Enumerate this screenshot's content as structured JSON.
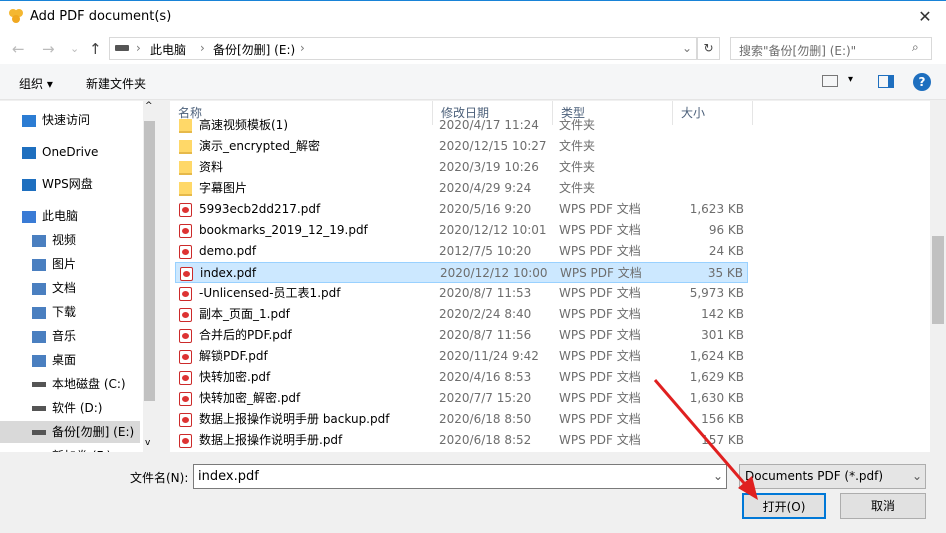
{
  "window": {
    "title": "Add PDF document(s)",
    "close": "✕"
  },
  "nav": {
    "back": "←",
    "forward": "→",
    "recent": "⌄",
    "up": "↑",
    "refresh": "↻",
    "path": [
      "此电脑",
      "备份[勿删] (E:)"
    ],
    "search_placeholder": "搜索\"备份[勿删] (E:)\""
  },
  "toolbar": {
    "organize": "组织 ▾",
    "new_folder": "新建文件夹",
    "help": "?"
  },
  "sidebar": {
    "items": [
      {
        "label": "快速访问",
        "icon": "star-icon"
      },
      {
        "label": "OneDrive",
        "icon": "cloud-icon"
      },
      {
        "label": "WPS网盘",
        "icon": "cloud-icon"
      },
      {
        "label": "此电脑",
        "icon": "computer-icon"
      },
      {
        "label": "视频",
        "icon": "video-icon"
      },
      {
        "label": "图片",
        "icon": "picture-icon"
      },
      {
        "label": "文档",
        "icon": "document-icon"
      },
      {
        "label": "下载",
        "icon": "download-icon"
      },
      {
        "label": "音乐",
        "icon": "music-icon"
      },
      {
        "label": "桌面",
        "icon": "desktop-icon"
      },
      {
        "label": "本地磁盘 (C:)",
        "icon": "drive-icon"
      },
      {
        "label": "软件 (D:)",
        "icon": "drive-icon"
      },
      {
        "label": "备份[勿删] (E:)",
        "icon": "drive-icon",
        "selected": true
      },
      {
        "label": "新加卷 (F:)",
        "icon": "drive-icon"
      }
    ]
  },
  "columns": [
    "名称",
    "修改日期",
    "类型",
    "大小"
  ],
  "files": [
    {
      "name": "高速视频模板(1)",
      "date": "2020/4/17 11:24",
      "type": "文件夹",
      "size": "",
      "kind": "folder"
    },
    {
      "name": "演示_encrypted_解密",
      "date": "2020/12/15 10:27",
      "type": "文件夹",
      "size": "",
      "kind": "folder"
    },
    {
      "name": "资料",
      "date": "2020/3/19 10:26",
      "type": "文件夹",
      "size": "",
      "kind": "folder"
    },
    {
      "name": "字幕图片",
      "date": "2020/4/29 9:24",
      "type": "文件夹",
      "size": "",
      "kind": "folder"
    },
    {
      "name": "5993ecb2dd217.pdf",
      "date": "2020/5/16 9:20",
      "type": "WPS PDF 文档",
      "size": "1,623 KB",
      "kind": "pdf"
    },
    {
      "name": "bookmarks_2019_12_19.pdf",
      "date": "2020/12/12 10:01",
      "type": "WPS PDF 文档",
      "size": "96 KB",
      "kind": "pdf"
    },
    {
      "name": "demo.pdf",
      "date": "2012/7/5 10:20",
      "type": "WPS PDF 文档",
      "size": "24 KB",
      "kind": "pdf"
    },
    {
      "name": "index.pdf",
      "date": "2020/12/12 10:00",
      "type": "WPS PDF 文档",
      "size": "35 KB",
      "kind": "pdf",
      "selected": true
    },
    {
      "name": "-Unlicensed-员工表1.pdf",
      "date": "2020/8/7 11:53",
      "type": "WPS PDF 文档",
      "size": "5,973 KB",
      "kind": "pdf"
    },
    {
      "name": "副本_页面_1.pdf",
      "date": "2020/2/24 8:40",
      "type": "WPS PDF 文档",
      "size": "142 KB",
      "kind": "pdf"
    },
    {
      "name": "合并后的PDF.pdf",
      "date": "2020/8/7 11:56",
      "type": "WPS PDF 文档",
      "size": "301 KB",
      "kind": "pdf"
    },
    {
      "name": "解锁PDF.pdf",
      "date": "2020/11/24 9:42",
      "type": "WPS PDF 文档",
      "size": "1,624 KB",
      "kind": "pdf"
    },
    {
      "name": "快转加密.pdf",
      "date": "2020/4/16 8:53",
      "type": "WPS PDF 文档",
      "size": "1,629 KB",
      "kind": "pdf"
    },
    {
      "name": "快转加密_解密.pdf",
      "date": "2020/7/7 15:20",
      "type": "WPS PDF 文档",
      "size": "1,630 KB",
      "kind": "pdf"
    },
    {
      "name": "数据上报操作说明手册 backup.pdf",
      "date": "2020/6/18 8:50",
      "type": "WPS PDF 文档",
      "size": "156 KB",
      "kind": "pdf"
    },
    {
      "name": "数据上报操作说明手册.pdf",
      "date": "2020/6/18 8:52",
      "type": "WPS PDF 文档",
      "size": "157 KB",
      "kind": "pdf"
    }
  ],
  "footer": {
    "filename_label": "文件名(N):",
    "filename": "index.pdf",
    "filter": "Documents PDF (*.pdf)",
    "open": "打开(O)",
    "cancel": "取消"
  }
}
